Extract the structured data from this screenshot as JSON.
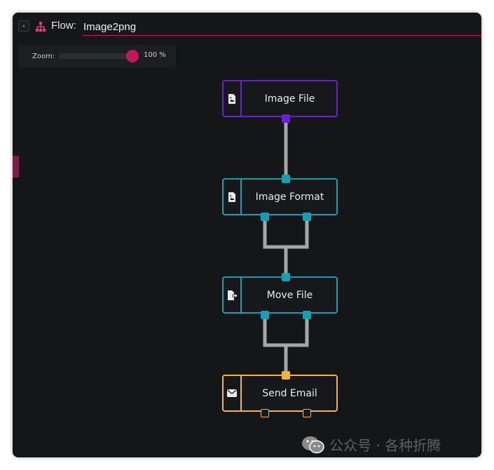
{
  "header": {
    "flow_label": "Flow:",
    "flow_name": "Image2png",
    "back_icon": "chevron-left-icon",
    "flow_icon": "sitemap-icon"
  },
  "zoom": {
    "label": "Zoom:",
    "value_text": "100 %",
    "level": 100,
    "max": 100
  },
  "nodes": [
    {
      "label": "Image File",
      "icon": "image-file-icon",
      "color": "#6a1fd6"
    },
    {
      "label": "Image Format",
      "icon": "image-file-icon",
      "color": "#12a0b3"
    },
    {
      "label": "Move File",
      "icon": "move-file-icon",
      "color": "#12a0b3"
    },
    {
      "label": "Send Email",
      "icon": "envelope-icon",
      "color": "#f2b53a"
    }
  ],
  "colors": {
    "accent": "#c2185b",
    "connector": "#a6a6a6",
    "canvas": "#151617"
  },
  "watermark": {
    "text": "公众号 · 各种折腾",
    "icon": "wechat-icon"
  }
}
